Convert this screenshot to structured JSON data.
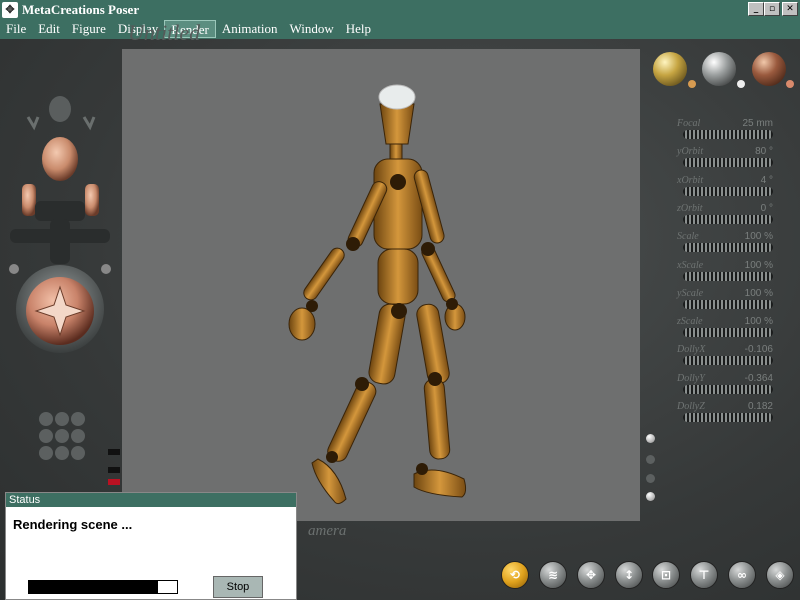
{
  "window": {
    "title": "MetaCreations Poser",
    "min": "_",
    "max": "▫",
    "close": "✕"
  },
  "menu": [
    {
      "label": "File"
    },
    {
      "label": "Edit"
    },
    {
      "label": "Figure"
    },
    {
      "label": "Display"
    },
    {
      "label": "Render"
    },
    {
      "label": "Animation"
    },
    {
      "label": "Window"
    },
    {
      "label": "Help"
    }
  ],
  "document_title": "Untitled",
  "camera_label": "amera",
  "parameters": [
    {
      "name": "Focal",
      "value": "25 mm"
    },
    {
      "name": "yOrbit",
      "value": "80 °"
    },
    {
      "name": "xOrbit",
      "value": "4 °"
    },
    {
      "name": "zOrbit",
      "value": "0 °"
    },
    {
      "name": "Scale",
      "value": "100 %"
    },
    {
      "name": "xScale",
      "value": "100 %"
    },
    {
      "name": "yScale",
      "value": "100 %"
    },
    {
      "name": "zScale",
      "value": "100 %"
    },
    {
      "name": "DollyX",
      "value": "-0.106"
    },
    {
      "name": "DollyY",
      "value": "-0.364"
    },
    {
      "name": "DollyZ",
      "value": "0.182"
    }
  ],
  "status": {
    "title": "Status",
    "message": "Rendering scene ...",
    "progress": 0.87,
    "stop_label": "Stop"
  },
  "colors": {
    "chrome": "#3d6f62",
    "viewport": "#6e6f6f",
    "figure": "#c9892c"
  }
}
